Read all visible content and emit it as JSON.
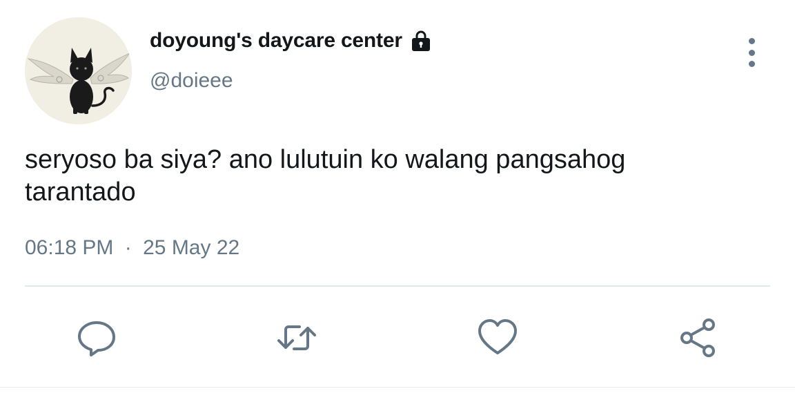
{
  "user": {
    "display_name": "doyoung's daycare center",
    "handle": "@doieee",
    "avatar_icon": "black-cat-with-wings-avatar",
    "protected_icon": "lock-icon"
  },
  "tweet": {
    "text": "seryoso ba siya? ano lulutuin ko walang pangsahog\ntarantado",
    "time": "06:18 PM",
    "separator": "·",
    "date": "25 May 22"
  },
  "actions": {
    "reply_icon": "reply-icon",
    "retweet_icon": "retweet-icon",
    "like_icon": "heart-icon",
    "share_icon": "share-icon",
    "more_icon": "more-vertical-icon"
  },
  "colors": {
    "text_primary": "#14171a",
    "text_secondary": "#657786",
    "divider": "#e1e8ed",
    "background": "#ffffff"
  }
}
